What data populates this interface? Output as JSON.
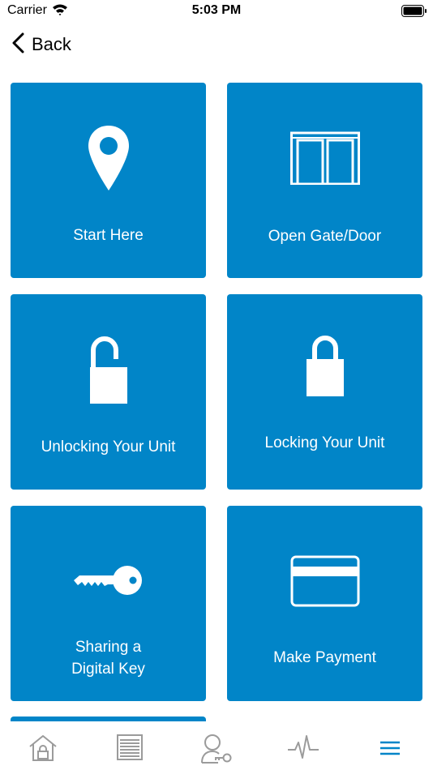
{
  "status_bar": {
    "carrier": "Carrier",
    "time": "5:03 PM"
  },
  "nav": {
    "back_label": "Back"
  },
  "tiles": [
    {
      "label": "Start Here",
      "icon": "map-pin-icon"
    },
    {
      "label": "Open Gate/Door",
      "icon": "gate-door-icon"
    },
    {
      "label": "Unlocking Your Unit",
      "icon": "unlocked-padlock-icon"
    },
    {
      "label": "Locking Your Unit",
      "icon": "locked-padlock-icon"
    },
    {
      "label_line1": "Sharing a",
      "label_line2": "Digital Key",
      "icon": "key-icon"
    },
    {
      "label": "Make Payment",
      "icon": "credit-card-icon"
    }
  ],
  "tab_bar": {
    "items": [
      {
        "icon": "home-lock-icon",
        "active": false
      },
      {
        "icon": "storage-unit-icon",
        "active": false
      },
      {
        "icon": "profile-key-icon",
        "active": false
      },
      {
        "icon": "activity-icon",
        "active": false
      },
      {
        "icon": "menu-icon",
        "active": true
      }
    ]
  },
  "colors": {
    "tile": "#0185C8",
    "active_tab": "#0185C8",
    "inactive_tab": "#9b9b9b"
  }
}
